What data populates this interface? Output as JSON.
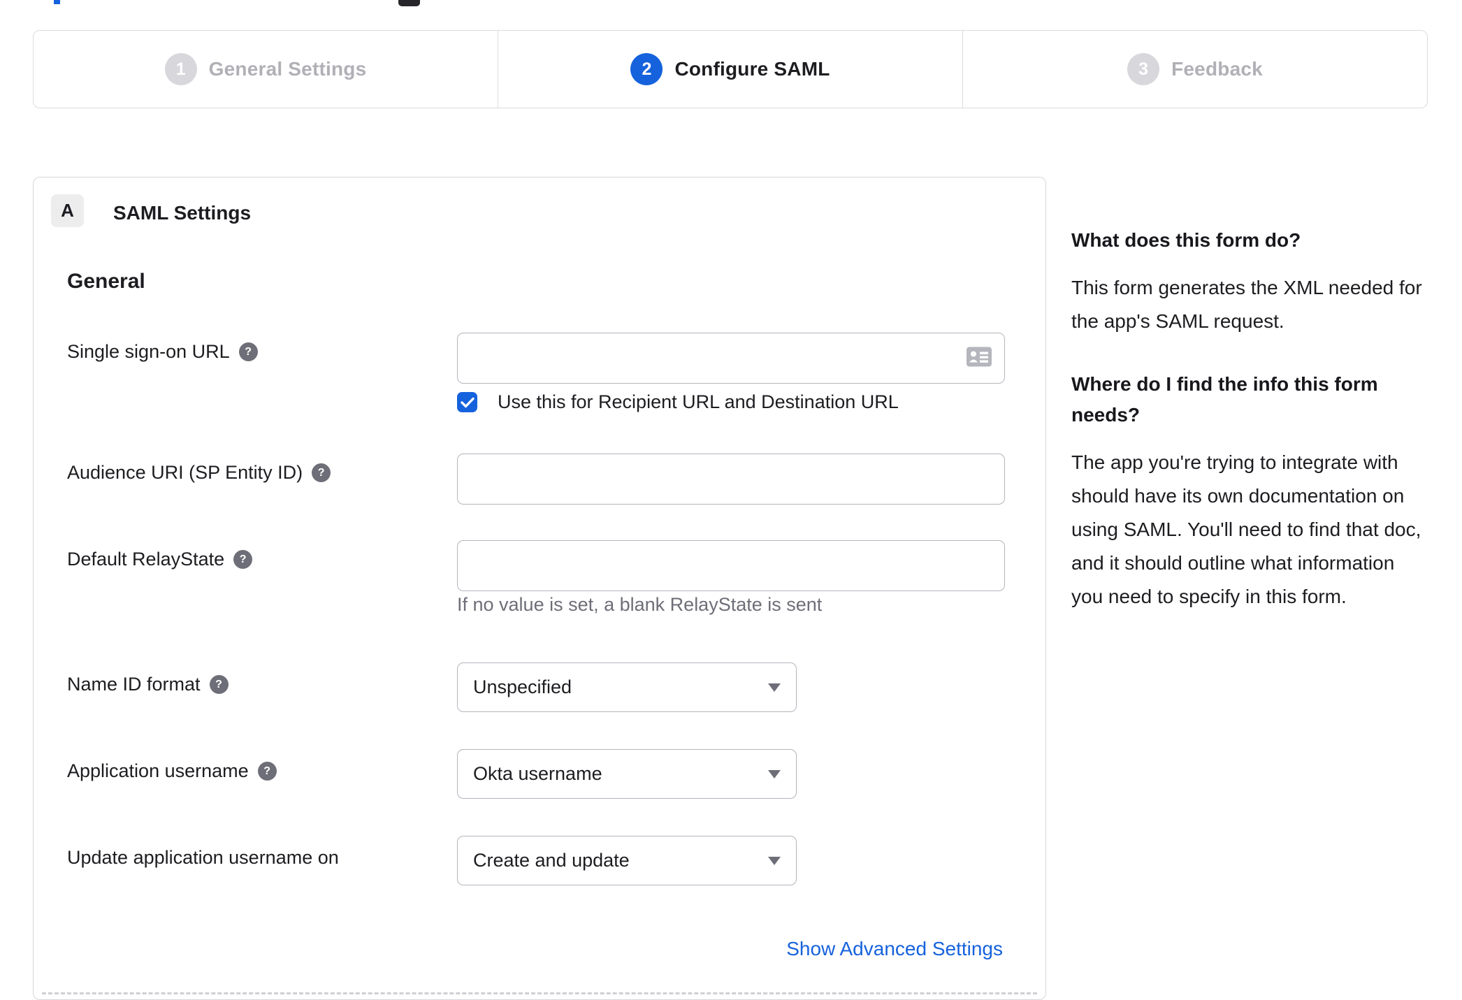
{
  "stepper": {
    "steps": [
      {
        "number": "1",
        "label": "General Settings",
        "state": "inactive"
      },
      {
        "number": "2",
        "label": "Configure SAML",
        "state": "active"
      },
      {
        "number": "3",
        "label": "Feedback",
        "state": "inactive"
      }
    ]
  },
  "panel": {
    "section_badge": "A",
    "section_title": "SAML Settings",
    "group_heading": "General"
  },
  "form": {
    "rows": [
      {
        "label": "Single sign-on URL",
        "type": "text",
        "value": "",
        "checkbox_checked": true,
        "checkbox_label": "Use this for Recipient URL and Destination URL"
      },
      {
        "label": "Audience URI (SP Entity ID)",
        "type": "text",
        "value": ""
      },
      {
        "label": "Default RelayState",
        "type": "text",
        "value": "",
        "hint": "If no value is set, a blank RelayState is sent"
      },
      {
        "label": "Name ID format",
        "type": "select",
        "value": "Unspecified"
      },
      {
        "label": "Application username",
        "type": "select",
        "value": "Okta username"
      },
      {
        "label": "Update application username on",
        "type": "select",
        "value": "Create and update"
      }
    ],
    "advanced_link": "Show Advanced Settings"
  },
  "sidebar": {
    "sections": [
      {
        "heading": "What does this form do?",
        "body": "This form generates the XML needed for the app's SAML request."
      },
      {
        "heading": "Where do I find the info this form needs?",
        "body": "The app you're trying to integrate with should have its own documentation on using SAML. You'll need to find that doc, and it should outline what information you need to specify in this form."
      }
    ]
  },
  "colors": {
    "accent": "#1662dd",
    "text": "#1d1d21",
    "muted": "#6e6e78",
    "panel_border": "#d7d7dc",
    "input_border": "#b4b4bc",
    "step_inactive": "#d7d7dc"
  }
}
